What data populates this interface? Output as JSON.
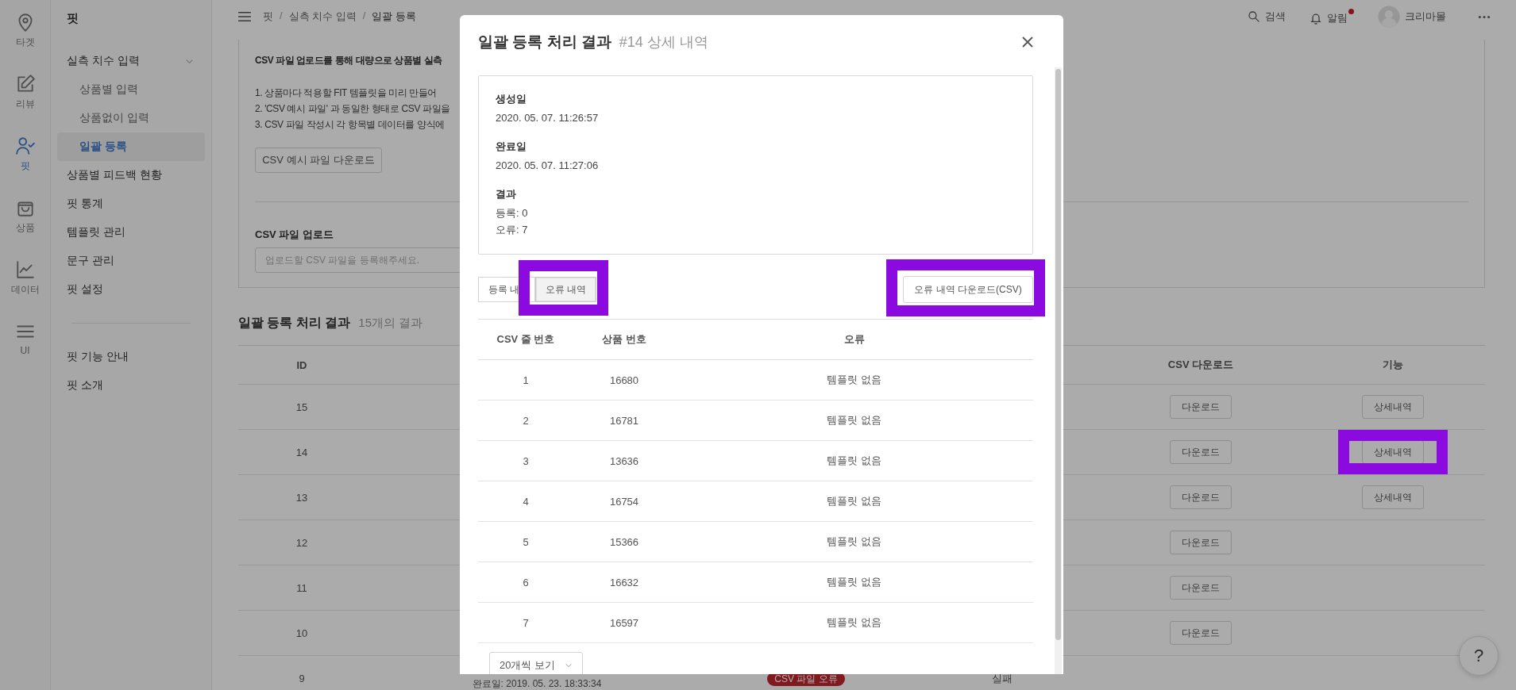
{
  "rail": [
    {
      "label": "타겟",
      "selected": false
    },
    {
      "label": "리뷰",
      "selected": false
    },
    {
      "label": "핏",
      "selected": true
    },
    {
      "label": "상품",
      "selected": false
    },
    {
      "label": "데이터",
      "selected": false
    },
    {
      "label": "UI",
      "selected": false
    }
  ],
  "sidebar": {
    "title": "핏",
    "items": [
      {
        "label": "실측 치수 입력",
        "selected": false,
        "expanded": true,
        "children": [
          {
            "label": "상품별 입력",
            "selected": false
          },
          {
            "label": "상품없이 입력",
            "selected": false
          },
          {
            "label": "일괄 등록",
            "selected": true
          }
        ]
      },
      {
        "label": "상품별 피드백 현황",
        "selected": false
      },
      {
        "label": "핏 통계",
        "selected": false
      },
      {
        "label": "템플릿 관리",
        "selected": false
      },
      {
        "label": "문구 관리",
        "selected": false
      },
      {
        "label": "핏 설정",
        "selected": false
      }
    ],
    "footer_items": [
      {
        "label": "핏 기능 안내"
      },
      {
        "label": "핏 소개"
      }
    ]
  },
  "header": {
    "breadcrumb": [
      {
        "kind": "link",
        "label": "핏"
      },
      {
        "kind": "separator",
        "label": "/"
      },
      {
        "kind": "link",
        "label": "실측 치수 입력"
      },
      {
        "kind": "separator",
        "label": "/"
      },
      {
        "kind": "current",
        "label": "일괄 등록"
      }
    ],
    "actions": [
      {
        "kind": "search",
        "label": "검색"
      },
      {
        "kind": "bell",
        "label": "알림",
        "unread": true
      },
      {
        "kind": "user",
        "label": "크리마몰"
      },
      {
        "kind": "more"
      }
    ]
  },
  "upload_card": {
    "title": "CSV 파일 업로드를 통해 대량으로 상품별 실측",
    "steps": [
      "1. 상품마다 적용할 FIT 템플릿을 미리 만들어",
      "2. 'CSV 예시 파일' 과 동일한 형태로 CSV 파일을",
      "3. CSV 파일 작성시 각 항목별 데이터를 양식에"
    ],
    "sample_button": "CSV 예시 파일 다운로드",
    "upload_label": "CSV 파일 업로드",
    "upload_placeholder": "업로드할 CSV 파일을 등록해주세요."
  },
  "results": {
    "title": "일괄 등록 처리 결과",
    "count": "15개의 결과",
    "columns": [
      "ID",
      "CSV 다운로드",
      "기능"
    ],
    "rows": [
      {
        "id": "15",
        "download": "다운로드",
        "detail": {
          "label": "상세내역",
          "highlighted": false
        }
      },
      {
        "id": "14",
        "download": "다운로드",
        "detail": {
          "label": "상세내역",
          "highlighted": true
        }
      },
      {
        "id": "13",
        "download": "다운로드",
        "detail": {
          "label": "상세내역",
          "highlighted": false
        }
      },
      {
        "id": "12",
        "download": "다운로드"
      },
      {
        "id": "11",
        "download": "다운로드"
      },
      {
        "id": "10",
        "download": "다운로드"
      },
      {
        "id": "9",
        "completed": "완료일: 2019. 05. 23. 18:33:34",
        "badge": "CSV 파일 오류",
        "status": "실패"
      }
    ]
  },
  "modal": {
    "title": "일괄 등록 처리 결과",
    "subtitle": "#14 상세 내역",
    "info": [
      {
        "label": "생성일",
        "lines": [
          "2020. 05. 07. 11:26:57"
        ]
      },
      {
        "label": "완료일",
        "lines": [
          "2020. 05. 07. 11:27:06"
        ]
      },
      {
        "label": "결과",
        "lines": [
          "등록: 0",
          "오류: 7"
        ]
      }
    ],
    "tabs": [
      {
        "label": "등록 내",
        "selected": false,
        "highlighted": false
      },
      {
        "label": "오류 내역",
        "selected": true,
        "highlighted": true
      }
    ],
    "download_button": {
      "label": "오류 내역 다운로드(CSV)",
      "highlighted": true
    },
    "columns": [
      "CSV 줄 번호",
      "상품 번호",
      "오류"
    ],
    "rows": [
      [
        "1",
        "16680",
        "템플릿 없음"
      ],
      [
        "2",
        "16781",
        "템플릿 없음"
      ],
      [
        "3",
        "13636",
        "템플릿 없음"
      ],
      [
        "4",
        "16754",
        "템플릿 없음"
      ],
      [
        "5",
        "15366",
        "템플릿 없음"
      ],
      [
        "6",
        "16632",
        "템플릿 없음"
      ],
      [
        "7",
        "16597",
        "템플릿 없음"
      ]
    ],
    "page_size": "20개씩 보기"
  },
  "help_button": "?"
}
